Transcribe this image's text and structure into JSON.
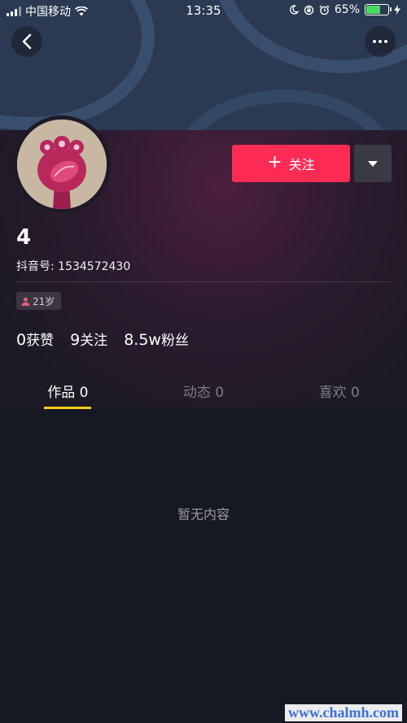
{
  "status_bar": {
    "carrier": "中国移动",
    "time": "13:35",
    "battery_percent": "65%",
    "battery_level": 0.65,
    "icons": [
      "signal-icon",
      "wifi-icon",
      "moon-icon",
      "rotation-lock-icon",
      "alarm-icon",
      "battery-icon",
      "charging-icon"
    ]
  },
  "nav": {
    "back_icon": "chevron-left-icon",
    "more_icon": "more-dots-icon"
  },
  "profile": {
    "nickname": "4",
    "douyin_id": "抖音号: 1534572430",
    "follow_label": "关注",
    "follow_prefix": "+",
    "age": "21岁",
    "stats": [
      {
        "value": "0",
        "label": "获赞"
      },
      {
        "value": "9",
        "label": "关注"
      },
      {
        "value": "8.5w",
        "label": "粉丝"
      }
    ]
  },
  "tabs": [
    {
      "label": "作品 0",
      "active": true
    },
    {
      "label": "动态 0",
      "active": false
    },
    {
      "label": "喜欢 0",
      "active": false
    }
  ],
  "content": {
    "empty_text": "暂无内容"
  },
  "watermark": "www.chalmh.com",
  "colors": {
    "accent": "#fe2c55",
    "tab_indicator": "#face15",
    "background": "#161823"
  }
}
